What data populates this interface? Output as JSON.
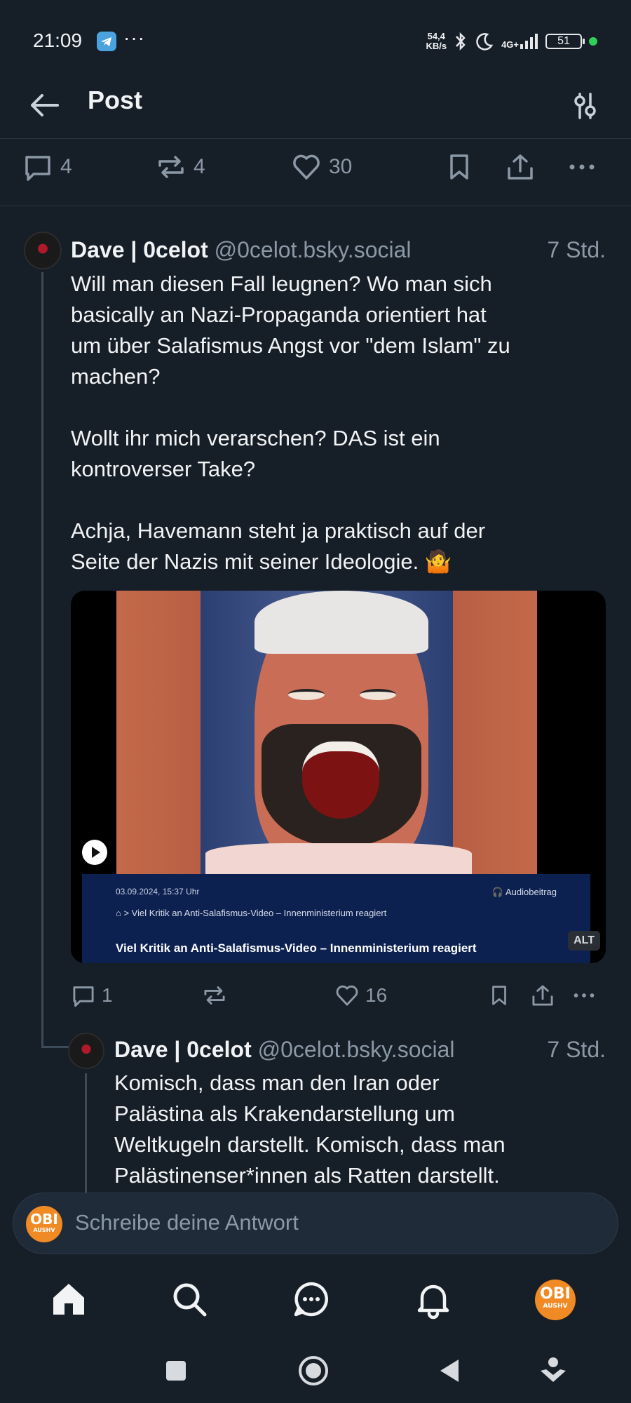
{
  "status_bar": {
    "time": "21:09",
    "dots": "···",
    "net_speed": "54,4",
    "net_unit": "KB/s",
    "network": "4G+",
    "battery": "51"
  },
  "header": {
    "title": "Post"
  },
  "top_actions": {
    "replies": "4",
    "reposts": "4",
    "likes": "30"
  },
  "post1": {
    "display_name": "Dave | 0celot",
    "handle": "@0celot.bsky.social",
    "time": "7 Std.",
    "text": "Will man diesen Fall leugnen? Wo man sich\nbasically an Nazi-Propaganda orientiert hat\num über Salafismus Angst vor \"dem Islam\" zu\nmachen?\n\nWollt ihr mich verarschen? DAS ist ein\nkontroverser Take?\n\nAchja, Havemann steht ja praktisch auf der\nSeite der Nazis mit seiner Ideologie. 🤷",
    "media": {
      "date": "03.09.2024, 15:37 Uhr",
      "audio": "Audiobeitrag",
      "breadcrumb": "> Viel Kritik an Anti-Salafismus-Video – Innenministerium reagiert",
      "title": "Viel Kritik an Anti-Salafismus-Video – Innenministerium reagiert",
      "alt_badge": "ALT"
    },
    "replies": "1",
    "likes": "16"
  },
  "post2": {
    "display_name": "Dave | 0celot",
    "handle": "@0celot.bsky.social",
    "time": "7 Std.",
    "text": "Komisch, dass man den Iran oder\nPalästina als Krakendarstellung um\nWeltkugeln darstellt. Komisch, dass man\nPalästinenser*innen als Ratten darstellt."
  },
  "reply_bar": {
    "placeholder": "Schreibe deine Antwort",
    "avatar_text": "OBI",
    "avatar_sub": "AUSHV"
  },
  "tabbar": {
    "avatar_text": "OBI",
    "avatar_sub": "AUSHV"
  },
  "colors": {
    "background": "#161e27",
    "muted": "#8b98a6",
    "accent_avatar": "#f08a24"
  }
}
